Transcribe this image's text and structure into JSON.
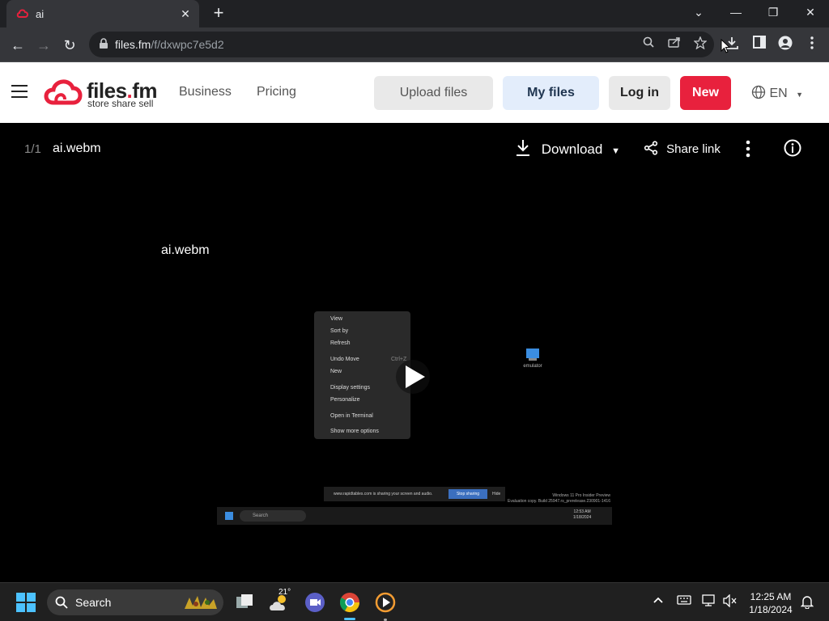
{
  "browser": {
    "tab_title": "ai",
    "tab_close": "✕",
    "new_tab": "+",
    "url_host": "files.fm",
    "url_path": "/f/dxwpc7e5d2"
  },
  "site": {
    "logo_text_a": "files",
    "logo_text_dot": ".",
    "logo_text_b": "fm",
    "logo_tagline": "store share sell",
    "nav": [
      "Business",
      "Pricing"
    ],
    "upload_label": "Upload files",
    "myfiles_label": "My files",
    "login_label": "Log in",
    "new_label": "New",
    "lang": "EN",
    "brand_color": "#e8213d"
  },
  "viewer": {
    "counter": "1/1",
    "filename": "ai.webm",
    "download_label": "Download",
    "share_label": "Share link",
    "video_title": "ai.webm"
  },
  "video_preview": {
    "menu_items": [
      "View",
      "Sort by",
      "Refresh",
      "Undo Move",
      "New",
      "Display settings",
      "Personalize",
      "Open in Terminal",
      "Show more options"
    ],
    "menu_shortcut": "Ctrl+Z",
    "desktop_icon": "emulator",
    "share_text": "www.rapidtables.com is sharing your screen and audio.",
    "stop_sharing": "Stop sharing",
    "hide": "Hide",
    "watermark_1": "Windows 11 Pro Insider Preview",
    "watermark_2": "Evaluation copy. Build 25947.rs_prerelease.230901-1416",
    "search": "Search",
    "time": "12:53 AM",
    "date": "1/18/2024"
  },
  "taskbar": {
    "search_label": "Search",
    "weather": "21°",
    "time": "12:25 AM",
    "date": "1/18/2024"
  }
}
